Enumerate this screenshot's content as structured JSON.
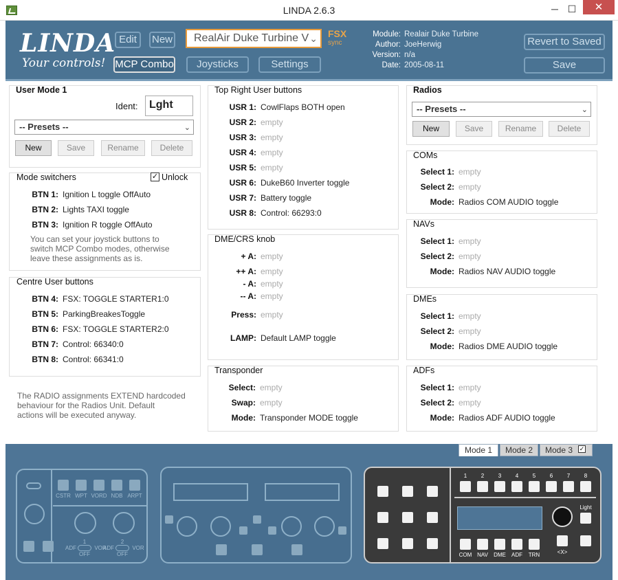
{
  "window": {
    "title": "LINDA 2.6.3",
    "minimize": "─",
    "maximize": "☐",
    "close": "✕"
  },
  "logo": {
    "main": "LINDA",
    "sub": "Your controls!"
  },
  "header": {
    "edit": "Edit",
    "new": "New",
    "module_select": "RealAir Duke Turbine V",
    "fsx": "FSX",
    "sync": "sync",
    "mcp_combo": "MCP Combo",
    "joysticks": "Joysticks",
    "settings": "Settings",
    "revert": "Revert to Saved",
    "save": "Save",
    "info": [
      {
        "k": "Module:",
        "v": "Realair Duke Turbine"
      },
      {
        "k": "Author:",
        "v": "JoeHerwig"
      },
      {
        "k": "Version:",
        "v": "n/a"
      },
      {
        "k": "Date:",
        "v": "2005-08-11"
      }
    ]
  },
  "user_mode": {
    "title": "User Mode 1",
    "ident_label": "Ident:",
    "ident_value": "Lght",
    "presets": "-- Presets --",
    "new": "New",
    "save": "Save",
    "rename": "Rename",
    "delete": "Delete"
  },
  "mode_switchers": {
    "title": "Mode switchers",
    "unlock": "Unlock",
    "check": "✓",
    "rows": [
      {
        "k": "BTN 1:",
        "v": "Ignition L toggle OffAuto"
      },
      {
        "k": "BTN 2:",
        "v": "Lights TAXI toggle"
      },
      {
        "k": "BTN 3:",
        "v": "Ignition R toggle OffAuto"
      }
    ],
    "note": [
      "You can set your joystick buttons to",
      "switch MCP Combo modes, otherwise",
      "leave these assignments as is."
    ]
  },
  "centre": {
    "title": "Centre User buttons",
    "rows": [
      {
        "k": "BTN 4:",
        "v": "FSX: TOGGLE STARTER1:0"
      },
      {
        "k": "BTN 5:",
        "v": "ParkingBreakesToggle"
      },
      {
        "k": "BTN 6:",
        "v": "FSX: TOGGLE STARTER2:0"
      },
      {
        "k": "BTN 7:",
        "v": "Control: 66340:0"
      },
      {
        "k": "BTN 8:",
        "v": "Control: 66341:0"
      }
    ]
  },
  "radio_note": [
    "The RADIO assignments EXTEND hardcoded",
    "behaviour for the Radios Unit. Default",
    "actions will be executed anyway."
  ],
  "top_right": {
    "title": "Top Right User buttons",
    "rows": [
      {
        "k": "USR 1:",
        "v": "CowlFlaps BOTH open",
        "e": false
      },
      {
        "k": "USR 2:",
        "v": "empty",
        "e": true
      },
      {
        "k": "USR 3:",
        "v": "empty",
        "e": true
      },
      {
        "k": "USR 4:",
        "v": "empty",
        "e": true
      },
      {
        "k": "USR 5:",
        "v": "empty",
        "e": true
      },
      {
        "k": "USR 6:",
        "v": "DukeB60 Inverter toggle",
        "e": false
      },
      {
        "k": "USR 7:",
        "v": "Battery toggle",
        "e": false
      },
      {
        "k": "USR 8:",
        "v": "Control: 66293:0",
        "e": false
      }
    ]
  },
  "dme_crs": {
    "title": "DME/CRS knob",
    "rows": [
      {
        "k": "+ A:",
        "v": "empty"
      },
      {
        "k": "++ A:",
        "v": "empty"
      },
      {
        "k": "- A:",
        "v": "empty"
      },
      {
        "k": "-- A:",
        "v": "empty"
      },
      {
        "k": "Press:",
        "v": "empty"
      },
      {
        "k": "LAMP:",
        "v": "Default LAMP toggle"
      }
    ]
  },
  "transponder": {
    "title": "Transponder",
    "rows": [
      {
        "k": "Select:",
        "v": "empty"
      },
      {
        "k": "Swap:",
        "v": "empty"
      },
      {
        "k": "Mode:",
        "v": "Transponder MODE toggle"
      }
    ]
  },
  "radios": {
    "title": "Radios",
    "presets": "-- Presets --",
    "new": "New",
    "save": "Save",
    "rename": "Rename",
    "delete": "Delete"
  },
  "coms": {
    "title": "COMs",
    "rows": [
      {
        "k": "Select 1:",
        "v": "empty"
      },
      {
        "k": "Select 2:",
        "v": "empty"
      },
      {
        "k": "Mode:",
        "v": "Radios COM AUDIO toggle"
      }
    ]
  },
  "navs": {
    "title": "NAVs",
    "rows": [
      {
        "k": "Select 1:",
        "v": "empty"
      },
      {
        "k": "Select 2:",
        "v": "empty"
      },
      {
        "k": "Mode:",
        "v": "Radios NAV AUDIO toggle"
      }
    ]
  },
  "dmes": {
    "title": "DMEs",
    "rows": [
      {
        "k": "Select 1:",
        "v": "empty"
      },
      {
        "k": "Select 2:",
        "v": "empty"
      },
      {
        "k": "Mode:",
        "v": "Radios DME AUDIO toggle"
      }
    ]
  },
  "adfs": {
    "title": "ADFs",
    "rows": [
      {
        "k": "Select 1:",
        "v": "empty"
      },
      {
        "k": "Select 2:",
        "v": "empty"
      },
      {
        "k": "Mode:",
        "v": "Radios ADF AUDIO toggle"
      }
    ]
  },
  "mode_tabs": [
    "Mode 1",
    "Mode 2",
    "Mode 3"
  ],
  "device": {
    "left_labels": [
      "CSTR",
      "WPT",
      "VORD",
      "NDB",
      "ARPT"
    ],
    "switch_labels": [
      "ADF",
      "VOR",
      "ADF",
      "VOR"
    ],
    "switch_nums": [
      "1",
      "2"
    ],
    "off": "OFF",
    "mcp_nums": [
      "1",
      "2",
      "3",
      "4",
      "5",
      "6",
      "7",
      "8"
    ],
    "mcp_bottom": [
      "COM",
      "NAV",
      "DME",
      "ADF",
      "TRN"
    ],
    "light": "Light",
    "x": "<X>"
  }
}
